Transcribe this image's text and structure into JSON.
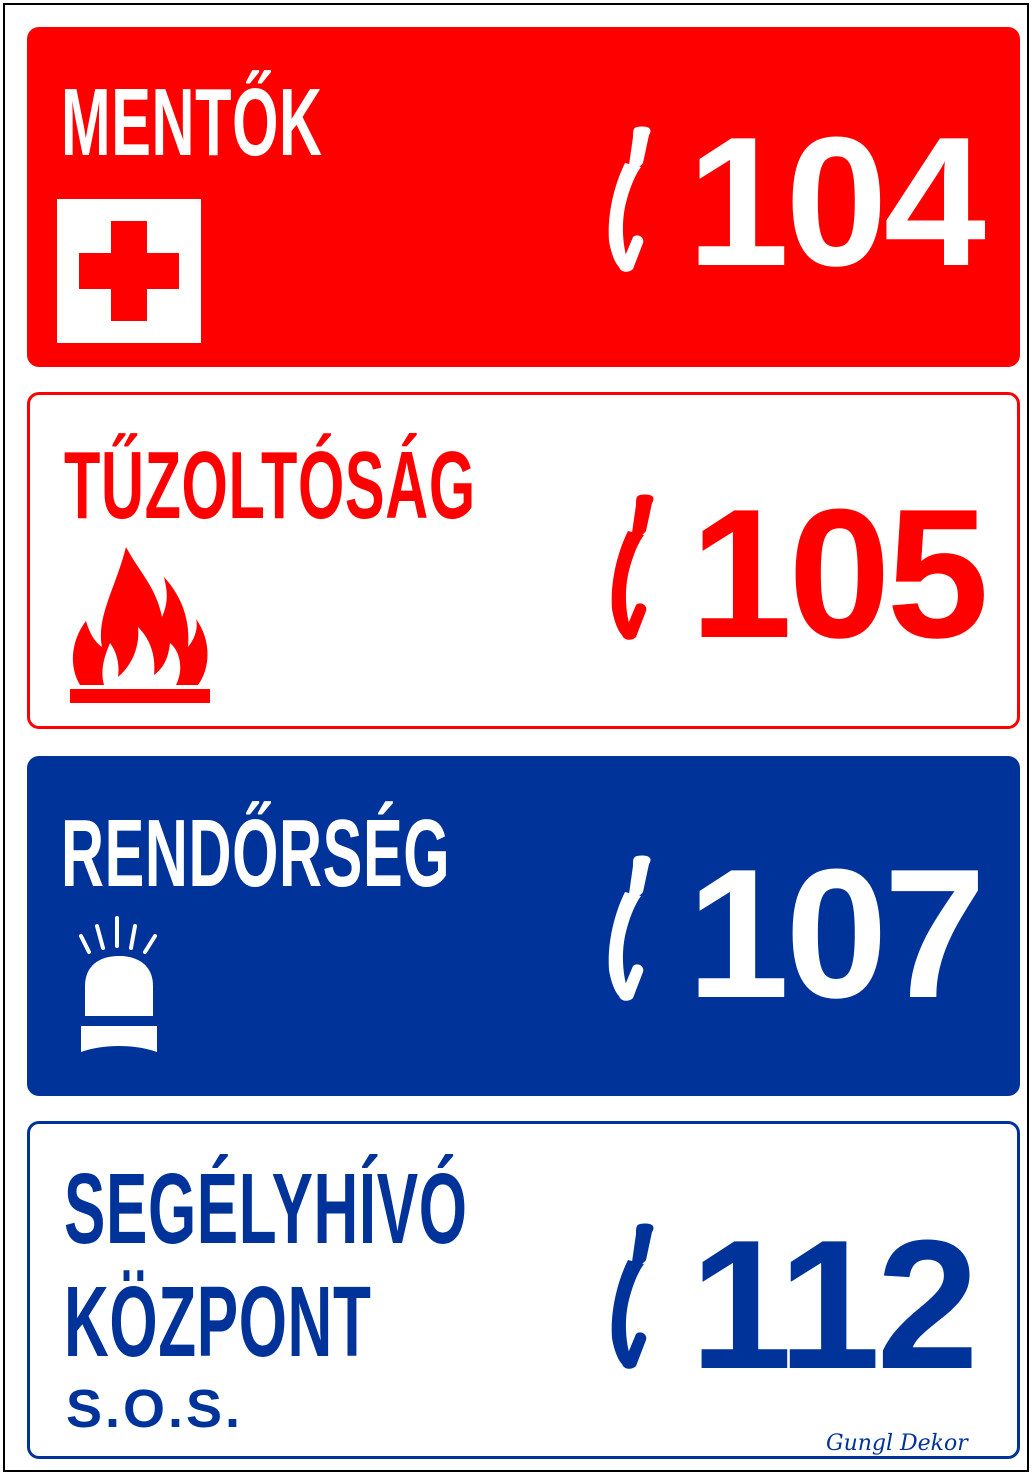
{
  "colors": {
    "red": "#ff0000",
    "blue": "#003399",
    "white": "#ffffff"
  },
  "panels": [
    {
      "title": "MENTŐK",
      "number": "104",
      "icon": "red-cross-icon"
    },
    {
      "title": "TŰZOLTÓSÁG",
      "number": "105",
      "icon": "flame-icon"
    },
    {
      "title": "RENDŐRSÉG",
      "number": "107",
      "icon": "police-beacon-icon"
    },
    {
      "title_line1": "SEGÉLYHÍVÓ",
      "title_line2": "KÖZPONT",
      "subtitle": "S.O.S.",
      "number": "112"
    }
  ],
  "brand": "Gungl Dekor"
}
